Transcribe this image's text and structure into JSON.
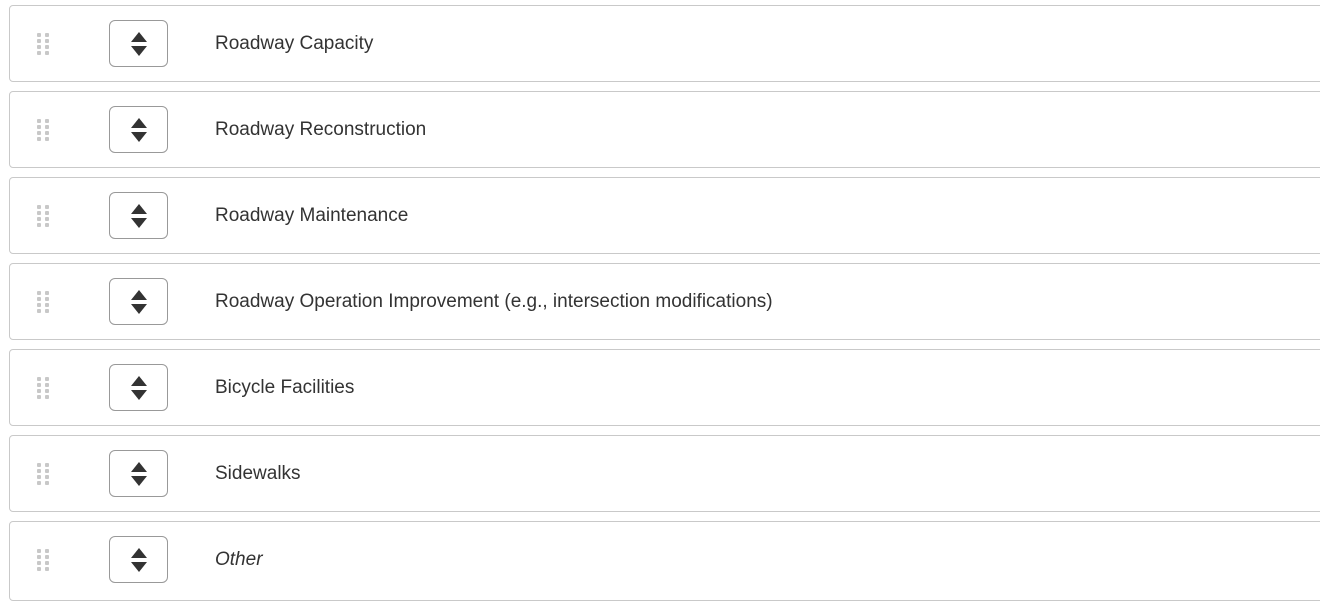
{
  "ranking_list": {
    "items": [
      {
        "label": "Roadway Capacity",
        "italic": false
      },
      {
        "label": "Roadway Reconstruction",
        "italic": false
      },
      {
        "label": "Roadway Maintenance",
        "italic": false
      },
      {
        "label": "Roadway Operation Improvement (e.g., intersection modifications)",
        "italic": false
      },
      {
        "label": "Bicycle Facilities",
        "italic": false
      },
      {
        "label": "Sidewalks",
        "italic": false
      },
      {
        "label": "Other",
        "italic": true
      }
    ]
  },
  "icons": {
    "drag_handle": "drag-dots-icon",
    "rank_select": "sort-arrows-icon"
  },
  "colors": {
    "border": "#c9c9c9",
    "text": "#333333",
    "handle_dots": "#c8c8c8",
    "select_border": "#999999",
    "arrows": "#333333"
  }
}
